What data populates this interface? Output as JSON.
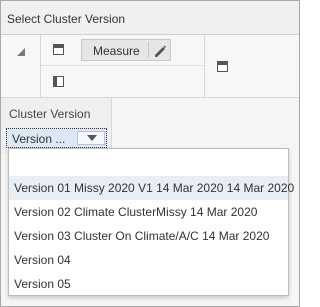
{
  "dialog": {
    "title": "Select Cluster Version"
  },
  "pivot": {
    "measure_label": "Measure"
  },
  "filter": {
    "label": "Cluster Version",
    "selected_value": "Version ...",
    "options": [
      "Version 01 Missy 2020 V1 14 Mar 2020 14 Mar 2020",
      "Version 02 Climate ClusterMissy 14 Mar 2020",
      "Version 03 Cluster On Climate/A/C 14 Mar 2020",
      "Version 04",
      "Version 05"
    ]
  },
  "colors": {
    "selected_bg": "#dce8f5",
    "hover_bg": "#e9eef4"
  }
}
